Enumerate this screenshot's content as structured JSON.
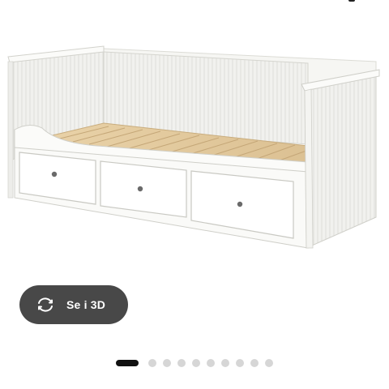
{
  "view_3d": {
    "label": "Se i 3D",
    "icon": "rotate-3d-icon"
  },
  "carousel": {
    "total_slides": 10,
    "active_index": 0
  },
  "colors": {
    "button_bg": "#484848",
    "dot_active": "#111111",
    "dot_inactive": "#d6d6d6"
  }
}
